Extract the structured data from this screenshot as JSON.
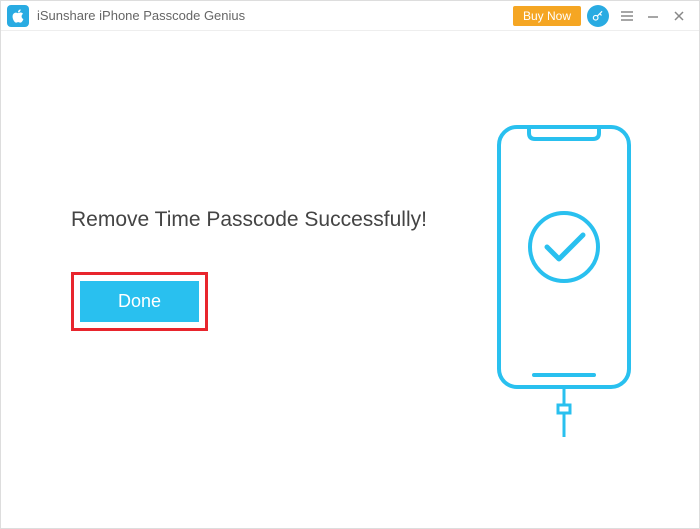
{
  "titlebar": {
    "app_name": "iSunshare iPhone Passcode Genius",
    "buy_now_label": "Buy Now"
  },
  "main": {
    "message": "Remove Time Passcode Successfully!",
    "done_label": "Done"
  },
  "colors": {
    "accent": "#29abe2",
    "buy_now": "#f5a623",
    "done_button": "#29c0ef",
    "highlight_border": "#e8252d"
  },
  "icons": {
    "app_icon": "apple-icon",
    "key": "key-icon",
    "menu": "menu-icon",
    "minimize": "minimize-icon",
    "close": "close-icon",
    "checkmark": "checkmark-icon",
    "phone": "phone-illustration"
  }
}
